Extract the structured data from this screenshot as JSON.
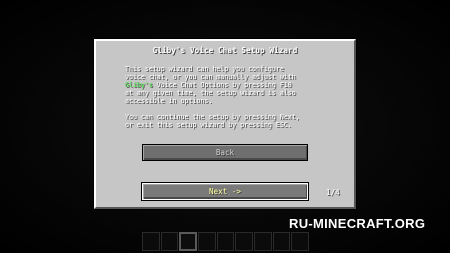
{
  "dialog": {
    "title": "Gliby's Voice Chat Setup Wizard",
    "lines": [
      "This setup wizard can help you configure",
      "voice chat, or you can manually adjust with",
      "Gliby's",
      " Voice Chat Options by pressing F10",
      "at any given time, the setup wizard is also",
      "accessible in options.",
      "You can continue the setup by pressing Next,",
      "or exit this setup wizard by pressing ESC."
    ],
    "back_label": "Back",
    "next_label": "Next ->",
    "page_indicator": "1/4"
  },
  "colors": {
    "brand_highlight": "#44ee44",
    "panel": "#c6c6c6",
    "button": "#6f6f6f"
  },
  "hotbar": {
    "slots": 9,
    "selected_index": 2
  },
  "watermark": "RU-MINECRAFT.ORG"
}
